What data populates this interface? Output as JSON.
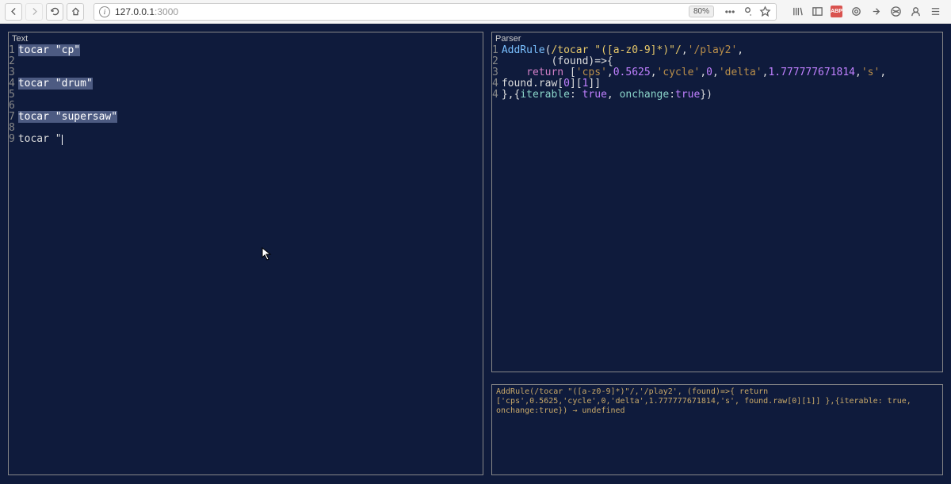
{
  "browser": {
    "url_host": "127.0.0.1",
    "url_port": ":3000",
    "zoom": "80%",
    "abp": "ABP"
  },
  "left": {
    "title": "Text",
    "lines": [
      {
        "n": "1",
        "kind": "hl",
        "text": "tocar \"cp\""
      },
      {
        "n": "2",
        "kind": "plain",
        "text": ""
      },
      {
        "n": "3",
        "kind": "plain",
        "text": ""
      },
      {
        "n": "4",
        "kind": "hl",
        "text": "tocar \"drum\""
      },
      {
        "n": "5",
        "kind": "plain",
        "text": ""
      },
      {
        "n": "6",
        "kind": "plain",
        "text": ""
      },
      {
        "n": "7",
        "kind": "hl",
        "text": "tocar \"supersaw\""
      },
      {
        "n": "8",
        "kind": "plain",
        "text": ""
      },
      {
        "n": "9",
        "kind": "cursor",
        "text": "tocar \""
      }
    ]
  },
  "right": {
    "title": "Parser",
    "l1": {
      "n": "1",
      "fn": "AddRule",
      "re": "/tocar \"([a-z0-9]*)\"/",
      "s1": "'/play2'"
    },
    "l2": {
      "n": "2",
      "indent": "        ",
      "arg": "found"
    },
    "l3": {
      "n": "3",
      "indent": "    ",
      "kw": "return",
      "s1": "'cps'",
      "n1": "0.5625",
      "s2": "'cycle'",
      "n2": "0",
      "s3": "'delta'",
      "n3": "1.777777671814",
      "s4": "'s'"
    },
    "l4": {
      "n": "4",
      "expr": "found.raw",
      "idx0": "0",
      "idx1": "1"
    },
    "l5": {
      "n": "4",
      "p1": "iterable",
      "v1": "true",
      "p2": "onchange",
      "v2": "true"
    }
  },
  "console": {
    "log": "AddRule(/tocar \"([a-z0-9]*)\"/,'/play2', (found)=>{ return ['cps',0.5625,'cycle',0,'delta',1.777777671814,'s', found.raw[0][1]] },{iterable: true, onchange:true}) → undefined"
  }
}
